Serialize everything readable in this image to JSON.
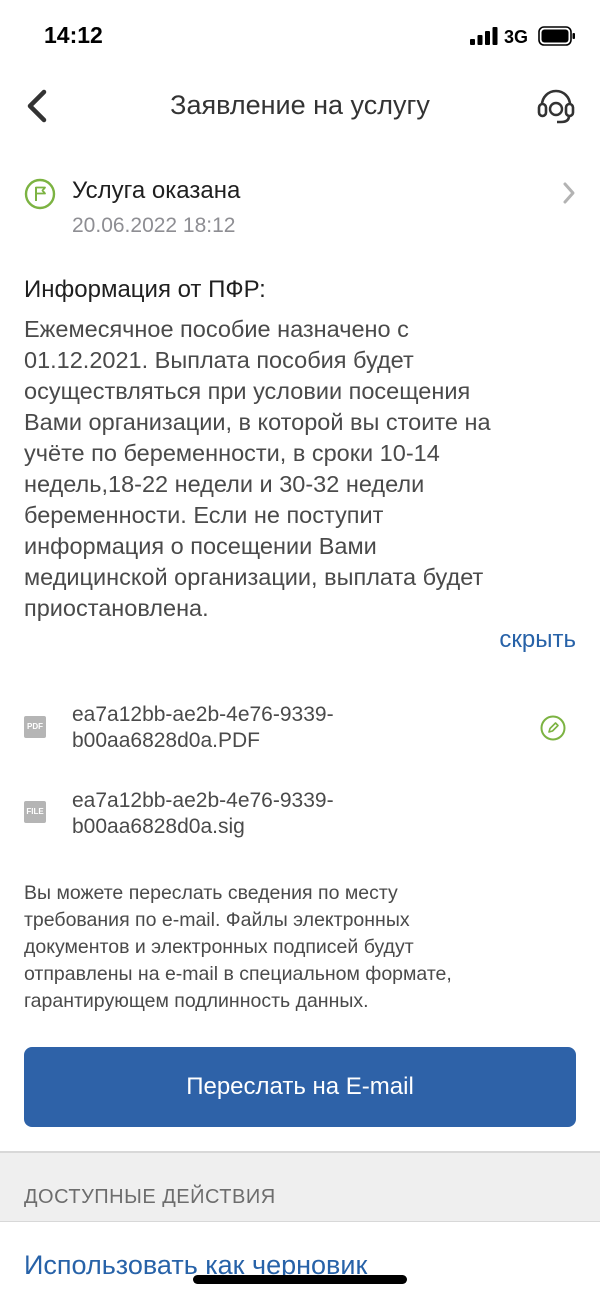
{
  "status_bar": {
    "time": "14:12",
    "network": "3G"
  },
  "header": {
    "title": "Заявление на услугу"
  },
  "status": {
    "title": "Услуга оказана",
    "date": "20.06.2022 18:12",
    "accent": "#7cb342"
  },
  "info": {
    "title": "Информация от ПФР:",
    "text": "Ежемесячное пособие назначено с\n01.12.2021. Выплата пособия будет\nосуществляться при условии посещения\nВами организации, в которой вы стоите на\nучёте по беременности, в сроки 10-14\nнедель,18-22 недели и 30-32 недели\nбеременности. Если не поступит\nинформация о посещении Вами\nмедицинской организации, выплата будет\nприостановлена.",
    "hide_label": "скрыть"
  },
  "files": [
    {
      "icon": "PDF",
      "name": "ea7a12bb-ae2b-4e76-9339-\nb00aa6828d0a.PDF"
    },
    {
      "icon": "FILE",
      "name": "ea7a12bb-ae2b-4e76-9339-\nb00aa6828d0a.sig"
    }
  ],
  "note": "Вы можете переслать сведения по месту\nтребования по e-mail. Файлы электронных\nдокументов и электронных подписей будут\nотправлены на e-mail в специальном формате,\nгарантирующем  подлинность данных.",
  "email_button": {
    "label": "Переслать на E-mail",
    "color": "#2e62a8"
  },
  "actions": {
    "title": "ДОСТУПНЫЕ ДЕЙСТВИЯ",
    "draft_label": "Использовать как черновик"
  },
  "colors": {
    "link": "#2762a8",
    "muted": "#8e8e93"
  }
}
